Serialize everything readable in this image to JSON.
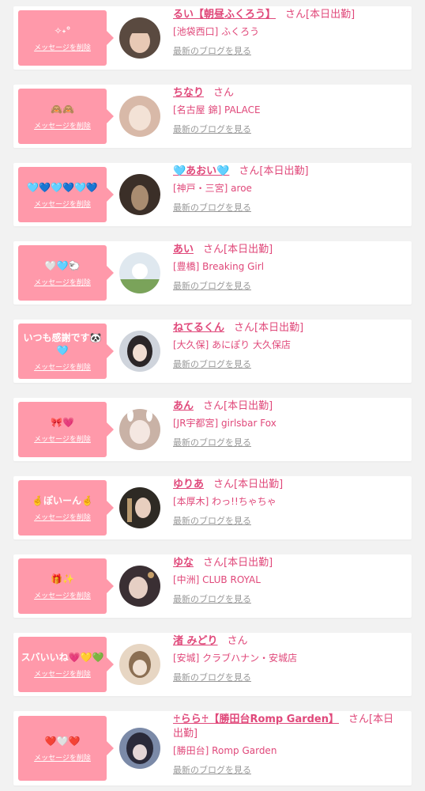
{
  "delete_label": "メッセージを削除",
  "blog_label": "最新のブログを見る",
  "san_label": "さん",
  "colors": {
    "bubble": "#ff99aa",
    "accent": "#e0487a",
    "muted": "#999999"
  },
  "cards": [
    {
      "message": "✧˖°",
      "name": "るい【朝昼ふくろう】",
      "tag": "[本日出勤]",
      "shop": "[池袋西口] ふくろう",
      "avatar_colors": [
        "#5a4a40",
        "#e8c9b5"
      ]
    },
    {
      "message": "🙈🙈",
      "name": "ちなり",
      "tag": "",
      "shop": "[名古屋 錦] PALACE",
      "avatar_colors": [
        "#d8b9a8",
        "#f3e2d6"
      ]
    },
    {
      "message": "🩵💙🩵💙🩵💙",
      "name": "🩵あおい🩵",
      "tag": "[本日出勤]",
      "shop": "[神戸・三宮] aroe",
      "avatar_colors": [
        "#3b2f28",
        "#a98c70"
      ]
    },
    {
      "message": "🤍🩵🐑",
      "name": "あい",
      "tag": "[本日出勤]",
      "shop": "[豊橋] Breaking Girl",
      "avatar_colors": [
        "#7aa35a",
        "#dfe8ef"
      ]
    },
    {
      "message": "いつも感謝です🐼🩵",
      "name": "ねてるくん",
      "tag": "[本日出勤]",
      "shop": "[大久保] あにぽり 大久保店",
      "avatar_colors": [
        "#2b2628",
        "#cfd4dc"
      ]
    },
    {
      "message": "🎀💗",
      "name": "あん",
      "tag": "[本日出勤]",
      "shop": "[JR宇都宮] girlsbar Fox",
      "avatar_colors": [
        "#c9b2a6",
        "#f4e7e1"
      ]
    },
    {
      "message": "🤞ぽいーん🤞",
      "name": "ゆりあ",
      "tag": "[本日出勤]",
      "shop": "[本厚木] わっ!!ちゃちゃ",
      "avatar_colors": [
        "#2e2a24",
        "#b99a6e"
      ]
    },
    {
      "message": "🎁✨",
      "name": "ゆな",
      "tag": "[本日出勤]",
      "shop": "[中洲] CLUB ROYAL",
      "avatar_colors": [
        "#3a2f33",
        "#c7a06a"
      ]
    },
    {
      "message": "スバいいね💗💛💚",
      "name": "渚 みどり",
      "tag": "",
      "shop": "[安城] クラブハナン・安城店",
      "avatar_colors": [
        "#8b6f53",
        "#e7d6c3"
      ]
    },
    {
      "message": "❤️🤍❤️",
      "name": "♰らら♰【勝田台Romp Garden】",
      "tag": "[本日出勤]",
      "shop": "[勝田台] Romp Garden",
      "avatar_colors": [
        "#2a2a3a",
        "#7b8aa8"
      ]
    }
  ]
}
